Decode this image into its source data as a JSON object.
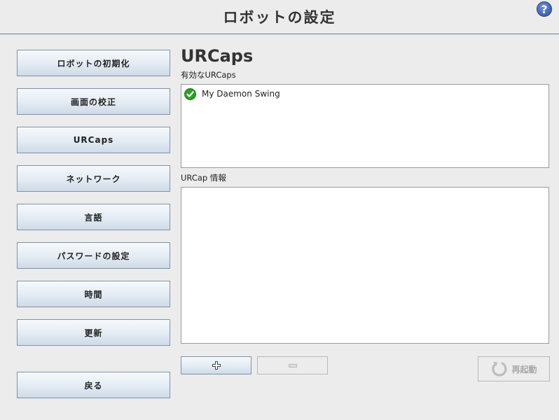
{
  "header": {
    "title": "ロボットの設定",
    "help_label": "?"
  },
  "sidebar": {
    "items": [
      {
        "label": "ロボットの初期化"
      },
      {
        "label": "画面の校正"
      },
      {
        "label": "URCaps"
      },
      {
        "label": "ネットワーク"
      },
      {
        "label": "言語"
      },
      {
        "label": "パスワードの設定"
      },
      {
        "label": "時間"
      },
      {
        "label": "更新"
      }
    ],
    "back_label": "戻る"
  },
  "main": {
    "title": "URCaps",
    "active_label": "有効なURCaps",
    "active_items": [
      {
        "name": "My Daemon Swing",
        "status": "active",
        "status_icon": "check-icon",
        "status_color": "#2f9f2a"
      }
    ],
    "info_label": "URCap 情報",
    "info_text": "",
    "add_button_icon": "plus-icon",
    "remove_button_icon": "minus-icon",
    "remove_enabled": false,
    "restart_label": "再起動",
    "restart_enabled": false
  },
  "colors": {
    "header_rule": "#5b7fa6",
    "button_border": "#7e94ab",
    "background": "#ececec"
  }
}
